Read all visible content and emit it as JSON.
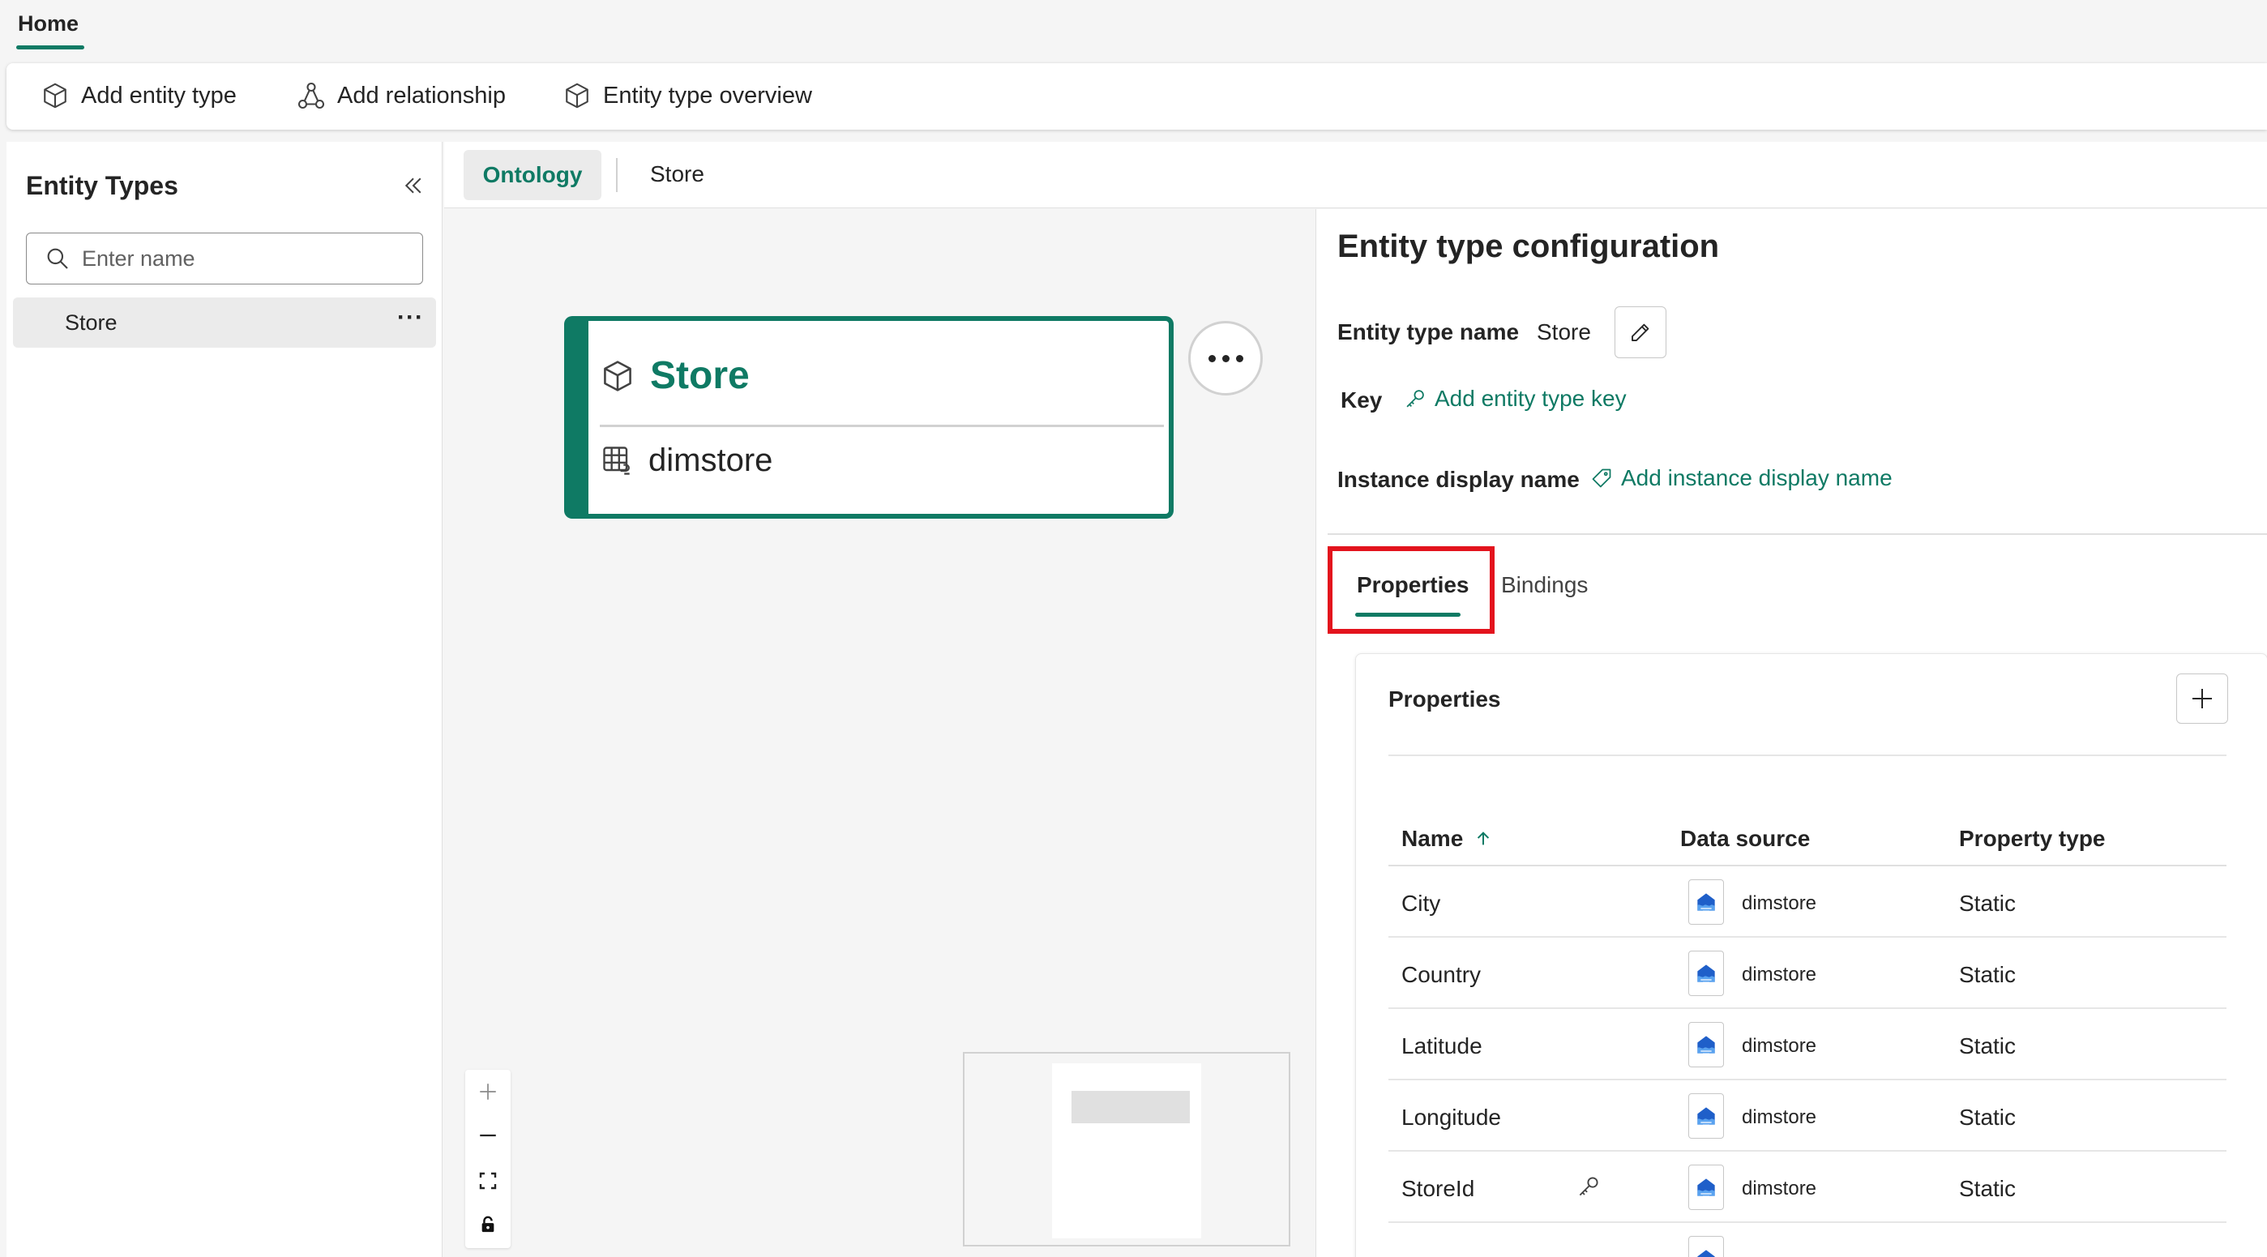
{
  "top_tab": {
    "label": "Home"
  },
  "toolbar": {
    "add_entity_type": "Add entity type",
    "add_relationship": "Add relationship",
    "entity_type_overview": "Entity type overview"
  },
  "left_panel": {
    "title": "Entity Types",
    "search_placeholder": "Enter name",
    "items": [
      {
        "label": "Store",
        "more": "···"
      }
    ]
  },
  "center_tabs": {
    "ontology": "Ontology",
    "store": "Store"
  },
  "node": {
    "title": "Store",
    "source": "dimstore"
  },
  "config": {
    "title": "Entity type configuration",
    "entity_type_name_label": "Entity type name",
    "entity_type_name_value": "Store",
    "key_label": "Key",
    "add_key": "Add entity type key",
    "instance_display_name_label": "Instance display name",
    "add_display_name": "Add instance display name",
    "tabs": {
      "properties": "Properties",
      "bindings": "Bindings"
    }
  },
  "properties": {
    "title": "Properties",
    "columns": {
      "name": "Name",
      "sort_icon": "arrow-up-icon",
      "data_source": "Data source",
      "property_type": "Property type"
    },
    "rows": [
      {
        "name": "City",
        "source": "dimstore",
        "type": "Static"
      },
      {
        "name": "Country",
        "source": "dimstore",
        "type": "Static"
      },
      {
        "name": "Latitude",
        "source": "dimstore",
        "type": "Static"
      },
      {
        "name": "Longitude",
        "source": "dimstore",
        "type": "Static"
      },
      {
        "name": "StoreId",
        "source": "dimstore",
        "type": "Static",
        "is_key": true
      }
    ]
  },
  "colors": {
    "accent": "#0f7a64",
    "highlight": "#e3131d"
  }
}
